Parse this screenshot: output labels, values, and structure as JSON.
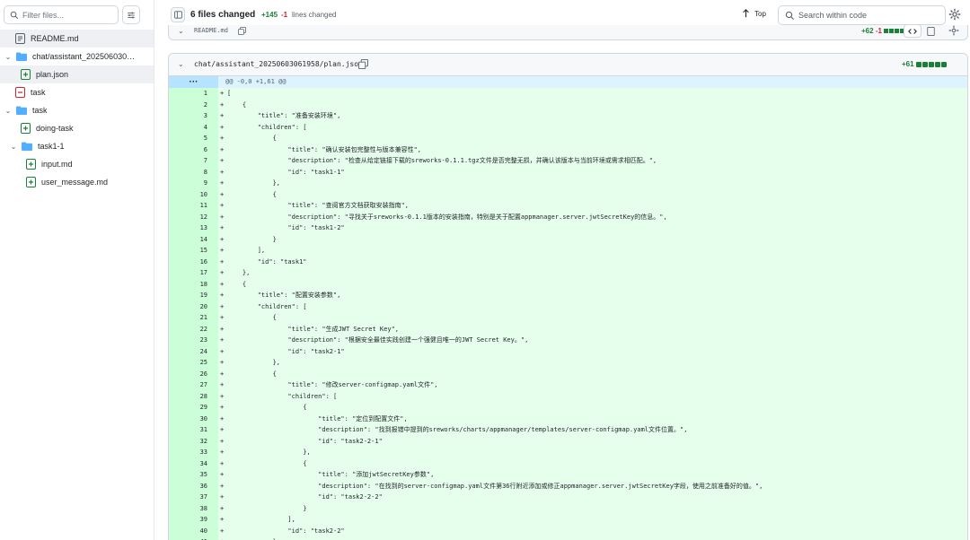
{
  "sidebar": {
    "filter_placeholder": "Filter files...",
    "items": [
      {
        "label": "README.md",
        "kind": "file",
        "status": "modified",
        "level": 0
      },
      {
        "label": "chat/assistant_20250603061958",
        "kind": "folder",
        "level": 0
      },
      {
        "label": "plan.json",
        "kind": "file",
        "status": "added",
        "level": 1
      },
      {
        "label": "task",
        "kind": "file",
        "status": "deleted",
        "level": 0
      },
      {
        "label": "task",
        "kind": "folder",
        "level": 0
      },
      {
        "label": "doing-task",
        "kind": "file",
        "status": "added",
        "level": 1
      },
      {
        "label": "task1-1",
        "kind": "folder",
        "level": 1
      },
      {
        "label": "input.md",
        "kind": "file",
        "status": "added",
        "level": 2
      },
      {
        "label": "user_message.md",
        "kind": "file",
        "status": "added",
        "level": 2
      }
    ]
  },
  "toolbar": {
    "files_changed": "6 files changed",
    "additions": "+145",
    "deletions": "-1",
    "lines_changed": "lines changed",
    "top_label": "Top",
    "search_placeholder": "Search within code"
  },
  "readme_diff": {
    "filename": "README.md",
    "additions": "+62",
    "deletions": "-1"
  },
  "plan_diff": {
    "filename": "chat/assistant_20250603061958/plan.json",
    "additions": "+61",
    "hunk_expand": "···",
    "hunk_header": "@@ -0,0 +1,61 @@",
    "lines": [
      {
        "n": "1",
        "text": "["
      },
      {
        "n": "2",
        "text": "    {"
      },
      {
        "n": "3",
        "text": "        \"title\": \"准备安装环境\","
      },
      {
        "n": "4",
        "text": "        \"children\": ["
      },
      {
        "n": "5",
        "text": "            {"
      },
      {
        "n": "6",
        "text": "                \"title\": \"确认安装包完整性与版本兼容性\","
      },
      {
        "n": "7",
        "text": "                \"description\": \"检查从给定链接下载的sreworks-0.1.1.tgz文件是否完整无损，并确认该版本与当前环境或需求相匹配。\","
      },
      {
        "n": "8",
        "text": "                \"id\": \"task1-1\""
      },
      {
        "n": "9",
        "text": "            },"
      },
      {
        "n": "10",
        "text": "            {"
      },
      {
        "n": "11",
        "text": "                \"title\": \"查阅官方文档获取安装指南\","
      },
      {
        "n": "12",
        "text": "                \"description\": \"寻找关于sreworks-0.1.1版本的安装指南，特别是关于配置appmanager.server.jwtSecretKey的信息。\","
      },
      {
        "n": "13",
        "text": "                \"id\": \"task1-2\""
      },
      {
        "n": "14",
        "text": "            }"
      },
      {
        "n": "15",
        "text": "        ],"
      },
      {
        "n": "16",
        "text": "        \"id\": \"task1\""
      },
      {
        "n": "17",
        "text": "    },"
      },
      {
        "n": "18",
        "text": "    {"
      },
      {
        "n": "19",
        "text": "        \"title\": \"配置安装参数\","
      },
      {
        "n": "20",
        "text": "        \"children\": ["
      },
      {
        "n": "21",
        "text": "            {"
      },
      {
        "n": "22",
        "text": "                \"title\": \"生成JWT Secret Key\","
      },
      {
        "n": "23",
        "text": "                \"description\": \"根据安全最佳实践创建一个强健且唯一的JWT Secret Key。\","
      },
      {
        "n": "24",
        "text": "                \"id\": \"task2-1\""
      },
      {
        "n": "25",
        "text": "            },"
      },
      {
        "n": "26",
        "text": "            {"
      },
      {
        "n": "27",
        "text": "                \"title\": \"修改server-configmap.yaml文件\","
      },
      {
        "n": "28",
        "text": "                \"children\": ["
      },
      {
        "n": "29",
        "text": "                    {"
      },
      {
        "n": "30",
        "text": "                        \"title\": \"定位到配置文件\","
      },
      {
        "n": "31",
        "text": "                        \"description\": \"找到报错中提到的sreworks/charts/appmanager/templates/server-configmap.yaml文件位置。\","
      },
      {
        "n": "32",
        "text": "                        \"id\": \"task2-2-1\""
      },
      {
        "n": "33",
        "text": "                    },"
      },
      {
        "n": "34",
        "text": "                    {"
      },
      {
        "n": "35",
        "text": "                        \"title\": \"添加jwtSecretKey参数\","
      },
      {
        "n": "36",
        "text": "                        \"description\": \"在找到的server-configmap.yaml文件第36行附近添加或修正appmanager.server.jwtSecretKey字段，使用之前准备好的值。\","
      },
      {
        "n": "37",
        "text": "                        \"id\": \"task2-2-2\""
      },
      {
        "n": "38",
        "text": "                    }"
      },
      {
        "n": "39",
        "text": "                ],"
      },
      {
        "n": "40",
        "text": "                \"id\": \"task2-2\""
      },
      {
        "n": "41",
        "text": "            }"
      }
    ]
  },
  "colors": {
    "addition_line_bg": "#e6ffec",
    "addition_gutter_bg": "#ccffd8",
    "hunk_bg": "#ddf4ff",
    "hunk_gutter_bg": "#b6e3ff",
    "added_green": "#1a7f37",
    "deleted_red": "#cf222e",
    "folder_blue": "#54aeff"
  },
  "icons": {
    "filter": "search-icon",
    "filter_options": "sliders-icon",
    "collapse": "sidebar-collapse-icon",
    "top": "arrow-up-icon",
    "search": "search-icon",
    "settings": "gear-icon",
    "copy": "copy-icon",
    "folder": "folder-icon",
    "file_added": "file-added-icon",
    "file_removed": "file-removed-icon",
    "file_modified": "file-modified-icon"
  }
}
